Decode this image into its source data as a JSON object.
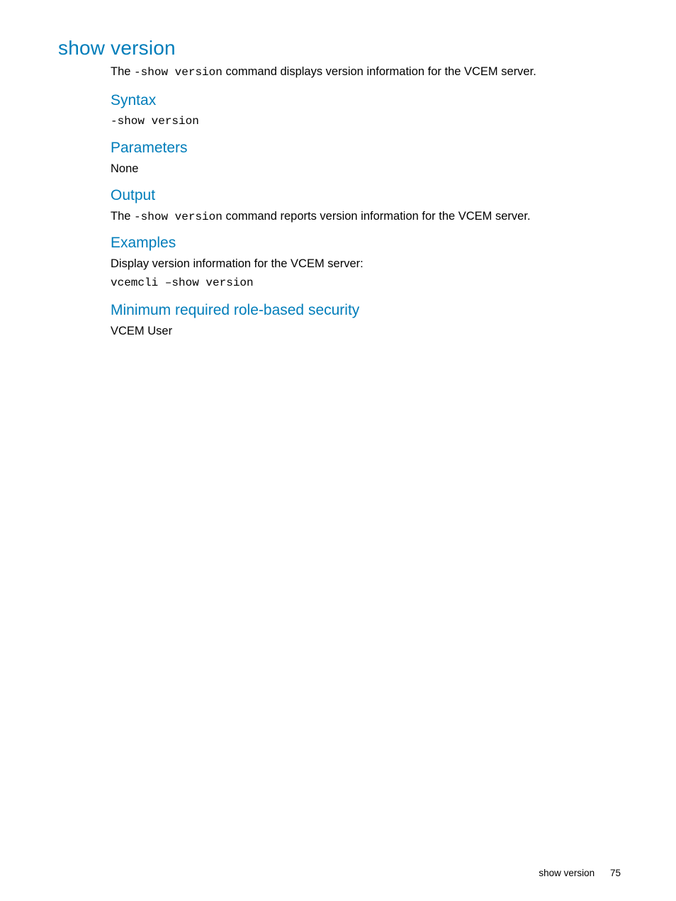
{
  "title": "show version",
  "intro": {
    "pre": "The ",
    "cmd": "-show version",
    "post": " command displays version information for the VCEM server."
  },
  "sections": {
    "syntax": {
      "heading": "Syntax",
      "code": "-show version"
    },
    "parameters": {
      "heading": "Parameters",
      "text": "None"
    },
    "output": {
      "heading": "Output",
      "pre": "The ",
      "cmd": "-show version",
      "post": " command reports version information for the VCEM server."
    },
    "examples": {
      "heading": "Examples",
      "text": "Display version information for the VCEM server:",
      "code": "vcemcli –show version"
    },
    "security": {
      "heading": "Minimum required role-based security",
      "text": "VCEM User"
    }
  },
  "footer": {
    "title": "show version",
    "page": "75"
  }
}
